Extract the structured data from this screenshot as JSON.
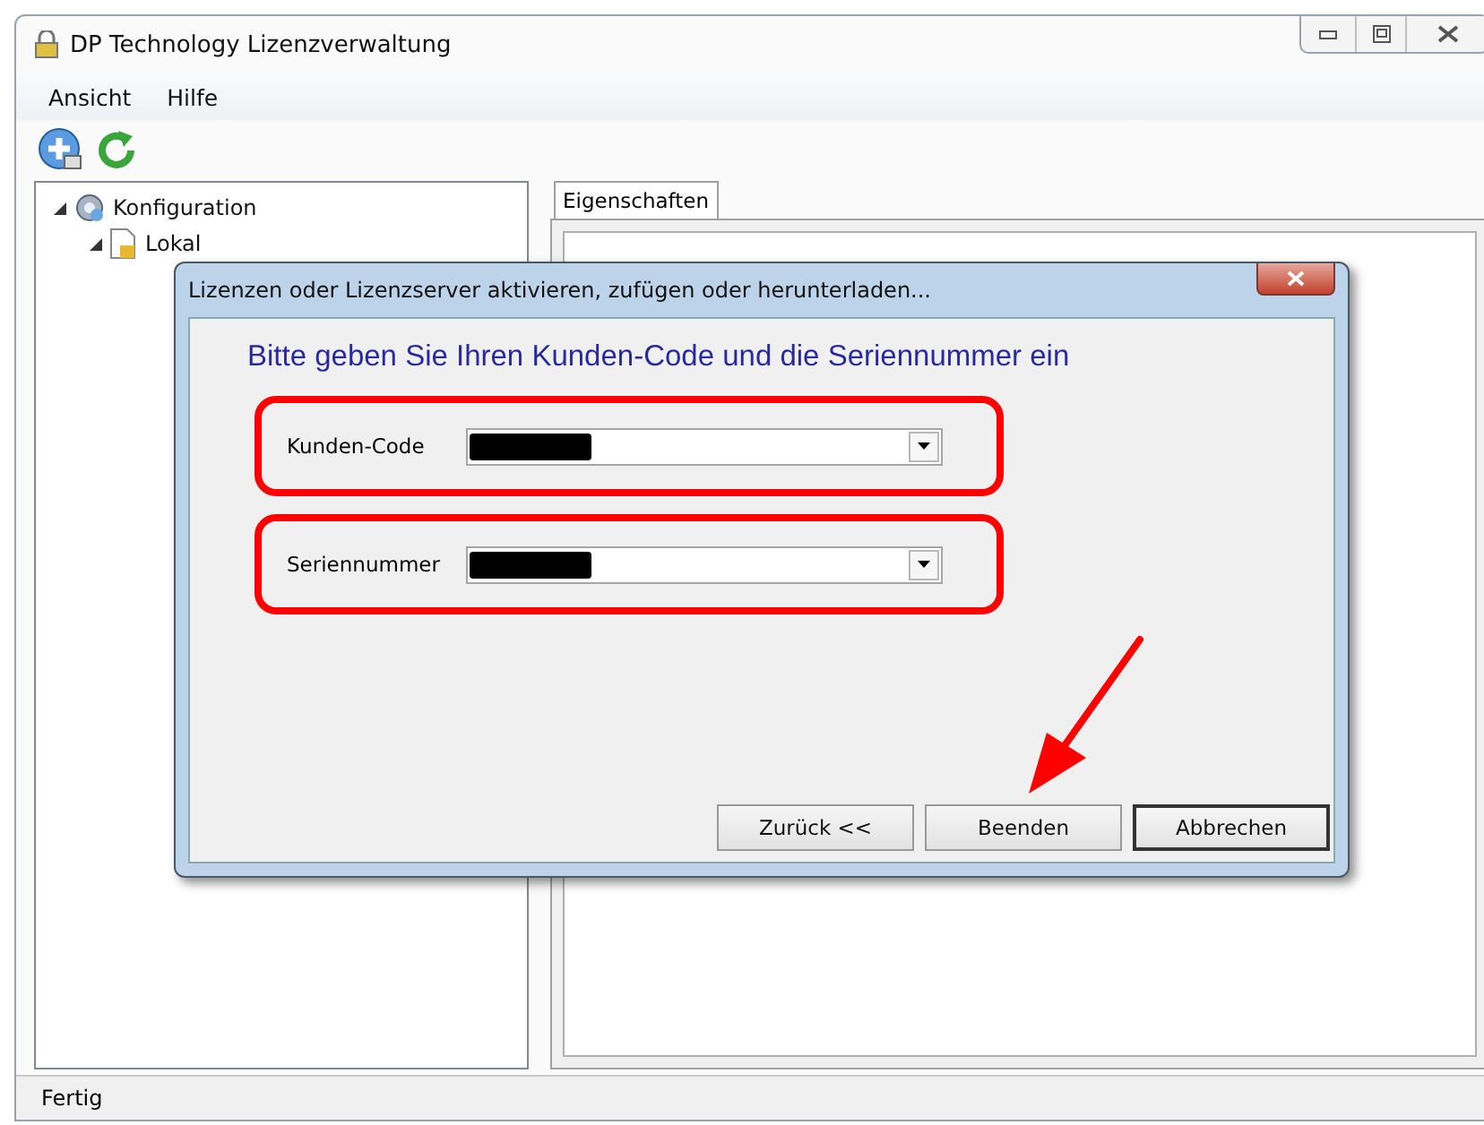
{
  "window": {
    "title": "DP Technology Lizenzverwaltung"
  },
  "menu": [
    "Ansicht",
    "Hilfe"
  ],
  "tree": [
    {
      "label": "Konfiguration",
      "expanded": true,
      "children": [
        {
          "label": "Lokal",
          "expanded": true
        }
      ]
    }
  ],
  "tabs": [
    {
      "label": "Eigenschaften",
      "selected": true
    }
  ],
  "status_bar": "Fertig",
  "dialog": {
    "title": "Lizenzen oder Lizenzserver aktivieren, zufügen oder herunterladen...",
    "heading": "Bitte geben Sie Ihren Kunden-Code und die Seriennummer ein",
    "fields": [
      {
        "label": "Kunden-Code",
        "redacted": true,
        "highlighted": true
      },
      {
        "label": "Seriennummer",
        "redacted": true,
        "highlighted": true
      }
    ],
    "buttons": [
      {
        "label": "Zurück <<",
        "default": false,
        "highlighted": false
      },
      {
        "label": "Beenden",
        "default": false,
        "highlighted": true
      },
      {
        "label": "Abbrechen",
        "default": true,
        "highlighted": false
      }
    ]
  }
}
